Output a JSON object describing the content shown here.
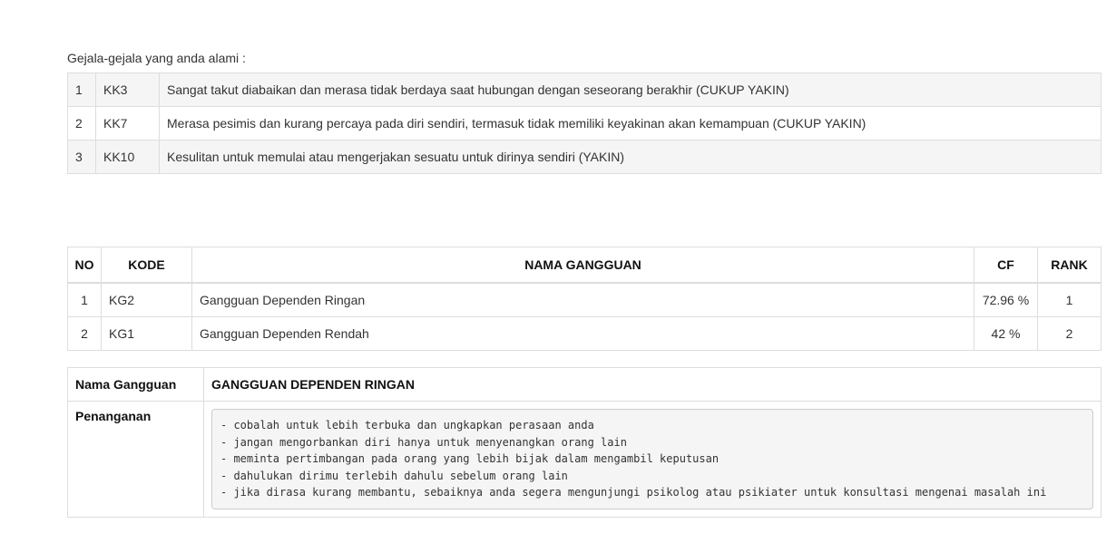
{
  "intro_label": "Gejala-gejala yang anda alami :",
  "symptoms": [
    {
      "no": "1",
      "code": "KK3",
      "text": "Sangat takut diabaikan dan merasa tidak berdaya saat hubungan dengan seseorang berakhir (CUKUP YAKIN)"
    },
    {
      "no": "2",
      "code": "KK7",
      "text": "Merasa pesimis dan kurang percaya pada diri sendiri, termasuk tidak memiliki keyakinan akan kemampuan (CUKUP YAKIN)"
    },
    {
      "no": "3",
      "code": "KK10",
      "text": "Kesulitan untuk memulai atau mengerjakan sesuatu untuk dirinya sendiri (YAKIN)"
    }
  ],
  "results": {
    "headers": {
      "no": "NO",
      "code": "KODE",
      "name": "NAMA GANGGUAN",
      "cf": "CF",
      "rank": "RANK"
    },
    "rows": [
      {
        "no": "1",
        "code": "KG2",
        "name": "Gangguan Dependen Ringan",
        "cf": "72.96 %",
        "rank": "1"
      },
      {
        "no": "2",
        "code": "KG1",
        "name": "Gangguan Dependen Rendah",
        "cf": "42 %",
        "rank": "2"
      }
    ]
  },
  "detail": {
    "name_label": "Nama Gangguan",
    "name_value": "GANGGUAN DEPENDEN RINGAN",
    "treatment_label": "Penanganan",
    "treatment_text": "- cobalah untuk lebih terbuka dan ungkapkan perasaan anda\n- jangan mengorbankan diri hanya untuk menyenangkan orang lain\n- meminta pertimbangan pada orang yang lebih bijak dalam mengambil keputusan\n- dahulukan dirimu terlebih dahulu sebelum orang lain\n- jika dirasa kurang membantu, sebaiknya anda segera mengunjungi psikolog atau psikiater untuk konsultasi mengenai masalah ini"
  }
}
